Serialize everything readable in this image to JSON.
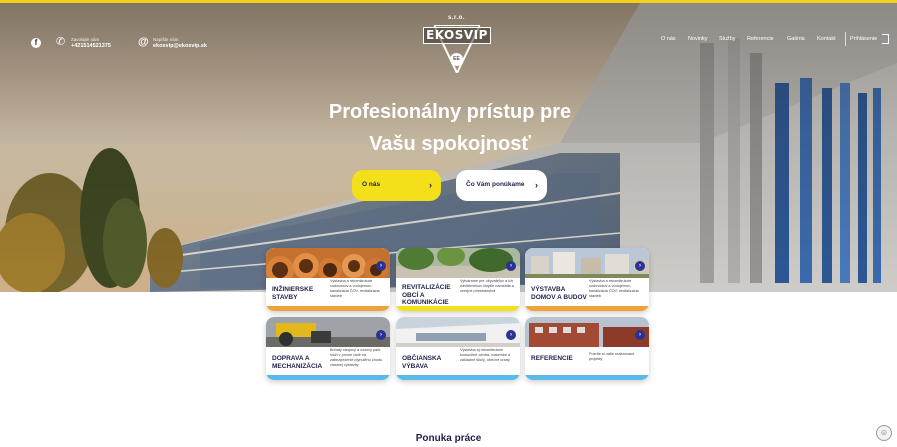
{
  "header": {
    "phone_label": "Zavolajte nám",
    "phone_number": "+421514521375",
    "email_label": "Napíšte nám",
    "email_address": "ekosvip@ekosvip.sk",
    "logo": {
      "suffix": "s.r.o.",
      "name": "EKOSVIP",
      "mark": "EE"
    }
  },
  "nav": {
    "items": [
      "O nás",
      "Novinky",
      "Služby",
      "Referencie",
      "Galéria",
      "Kontakt"
    ],
    "login": "Prihlásenie"
  },
  "hero": {
    "title_line1": "Profesionálny prístup pre",
    "title_line2": "Vašu spokojnosť",
    "btn_about": "O nás",
    "btn_offer": "Čo Vám ponúkame",
    "arrow": "›"
  },
  "services": [
    {
      "title": "INŽINIERSKE STAVBY",
      "desc": "Výstavba a rekonštrukcie vodovodov a vodojemov, kanalizácia ČOV, revitalizácia stavieb",
      "accent": "#f0a23a"
    },
    {
      "title": "REVITALIZÁCIE OBCÍ A KOMUNIKÁCIE",
      "desc": "Vytvárame pre obyvateľov a ich návštevníkov krajšie námestia a verejné priestranstvá",
      "accent": "#f3df1a"
    },
    {
      "title": "VÝSTAVBA DOMOV A BUDOV",
      "desc": "Výstavba a rekonštrukcie vodovodov a vodojemov, kanalizácia ČOV, revitalizácia stavieb",
      "accent": "#f0a23a"
    },
    {
      "title": "DOPRAVA A MECHANIZÁCIA",
      "desc": "Bohatý strojový a vozový park slúži v prvom rade na zabezpečenie plynulého chodu vlastnej výstavby",
      "accent": "#5bb8e8"
    },
    {
      "title": "OBČIANSKA VÝBAVA",
      "desc": "Výstavba aj rekonštrukcie komunitné centrá, materské a základné školy, obecné úrady",
      "accent": "#5bb8e8"
    },
    {
      "title": "REFERENCIE",
      "desc": "Pozrite si naše realizované projekty",
      "accent": "#5bb8e8"
    }
  ],
  "section": {
    "title": "Ponuka práce"
  },
  "colors": {
    "brand_yellow": "#f3df1a",
    "navy": "#1d2149",
    "arrow_blue": "#2a3391"
  },
  "icons": [
    "facebook-icon",
    "phone-icon",
    "at-icon",
    "login-icon",
    "chevron-right-icon",
    "cookie-icon"
  ]
}
